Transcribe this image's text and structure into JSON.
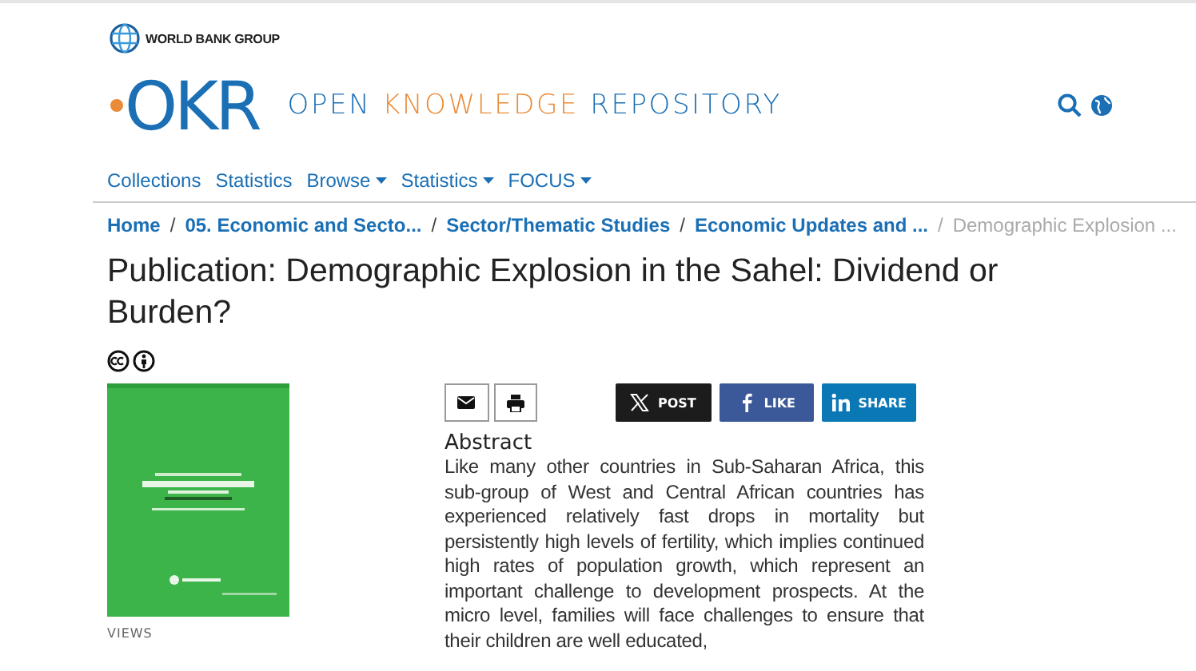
{
  "header": {
    "group_name": "WORLD BANK GROUP",
    "logo_text": "OKR",
    "site_title": [
      {
        "text": "OPEN",
        "accent": false
      },
      {
        "text": "KNOWLEDGE",
        "accent": true
      },
      {
        "text": "REPOSITORY",
        "accent": false
      }
    ]
  },
  "nav": [
    {
      "label": "Collections",
      "dropdown": false
    },
    {
      "label": "Statistics",
      "dropdown": false
    },
    {
      "label": "Browse",
      "dropdown": true
    },
    {
      "label": "Statistics",
      "dropdown": true
    },
    {
      "label": "FOCUS",
      "dropdown": true
    }
  ],
  "breadcrumb": [
    {
      "label": "Home",
      "current": false
    },
    {
      "separator": "/",
      "label": "05. Economic and Secto...",
      "current": false
    },
    {
      "separator": "/",
      "label": "Sector/Thematic Studies",
      "current": false
    },
    {
      "separator": "/",
      "label": "Economic Updates and ...",
      "current": false
    },
    {
      "separator": "/",
      "label": "Demographic Explosion ...",
      "current": true
    }
  ],
  "title": "Publication: Demographic Explosion in the Sahel: Dividend or Burden?",
  "views_label": "VIEWS",
  "share": [
    {
      "kind": "x",
      "label": "POST"
    },
    {
      "kind": "facebook",
      "label": "LIKE"
    },
    {
      "kind": "linkedin",
      "label": "SHARE"
    }
  ],
  "abstract": {
    "heading": "Abstract",
    "text": "Like many other countries in Sub-Saharan Africa, this sub-group of West and Central African countries has experienced relatively fast drops in mortality but persistently high levels of fertility, which implies continued high rates of population growth, which represent an important challenge to development prospects. At the micro level, families will face challenges to ensure that their children are well educated,"
  }
}
